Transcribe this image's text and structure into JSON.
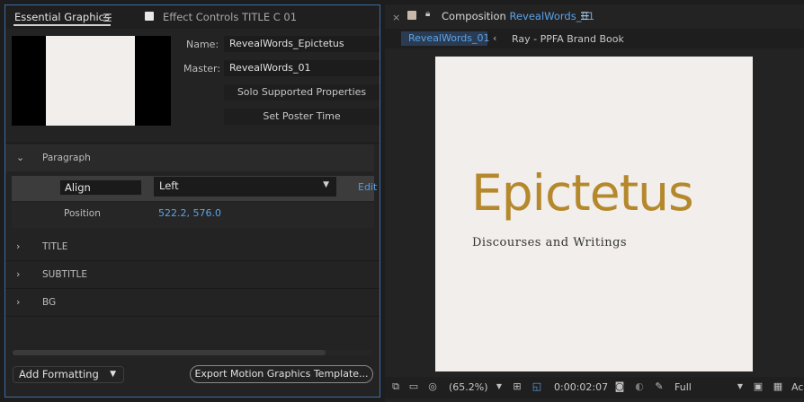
{
  "left_panel": {
    "tab_active": "Essential Graphics",
    "tab_menu_icon": "hamburger-icon",
    "tab_inactive": "Effect Controls TITLE C 01",
    "name_label": "Name:",
    "name_value": "RevealWords_Epictetus",
    "master_label": "Master:",
    "master_value": "RevealWords_01",
    "solo_button": "Solo Supported Properties",
    "poster_button": "Set Poster Time",
    "paragraph_section": "Paragraph",
    "align_label": "Align",
    "align_value": "Left",
    "edit_link": "Edit",
    "position_label": "Position",
    "position_value": "522.2, 576.0",
    "sections": [
      "TITLE",
      "SUBTITLE",
      "BG"
    ],
    "add_formatting": "Add Formatting",
    "export_button": "Export Motion Graphics Template..."
  },
  "right_panel": {
    "close_icon": "×",
    "comp_prefix": "Composition",
    "comp_name": "RevealWords_01",
    "subtab_active": "RevealWords_01",
    "subtab_arrow": "‹",
    "subtab_other": "Ray - PPFA Brand Book",
    "canvas_title": "Epictetus",
    "canvas_subtitle": "Discourses and Writings",
    "toolbar": {
      "zoom": "(65.2%)",
      "timecode": "0:00:02:07",
      "resolution": "Full",
      "trailing_text": "Ac"
    }
  },
  "colors": {
    "accent_blue": "#5aa3e8",
    "title_gold": "#b5882c",
    "canvas_bg": "#f1eeeb"
  }
}
